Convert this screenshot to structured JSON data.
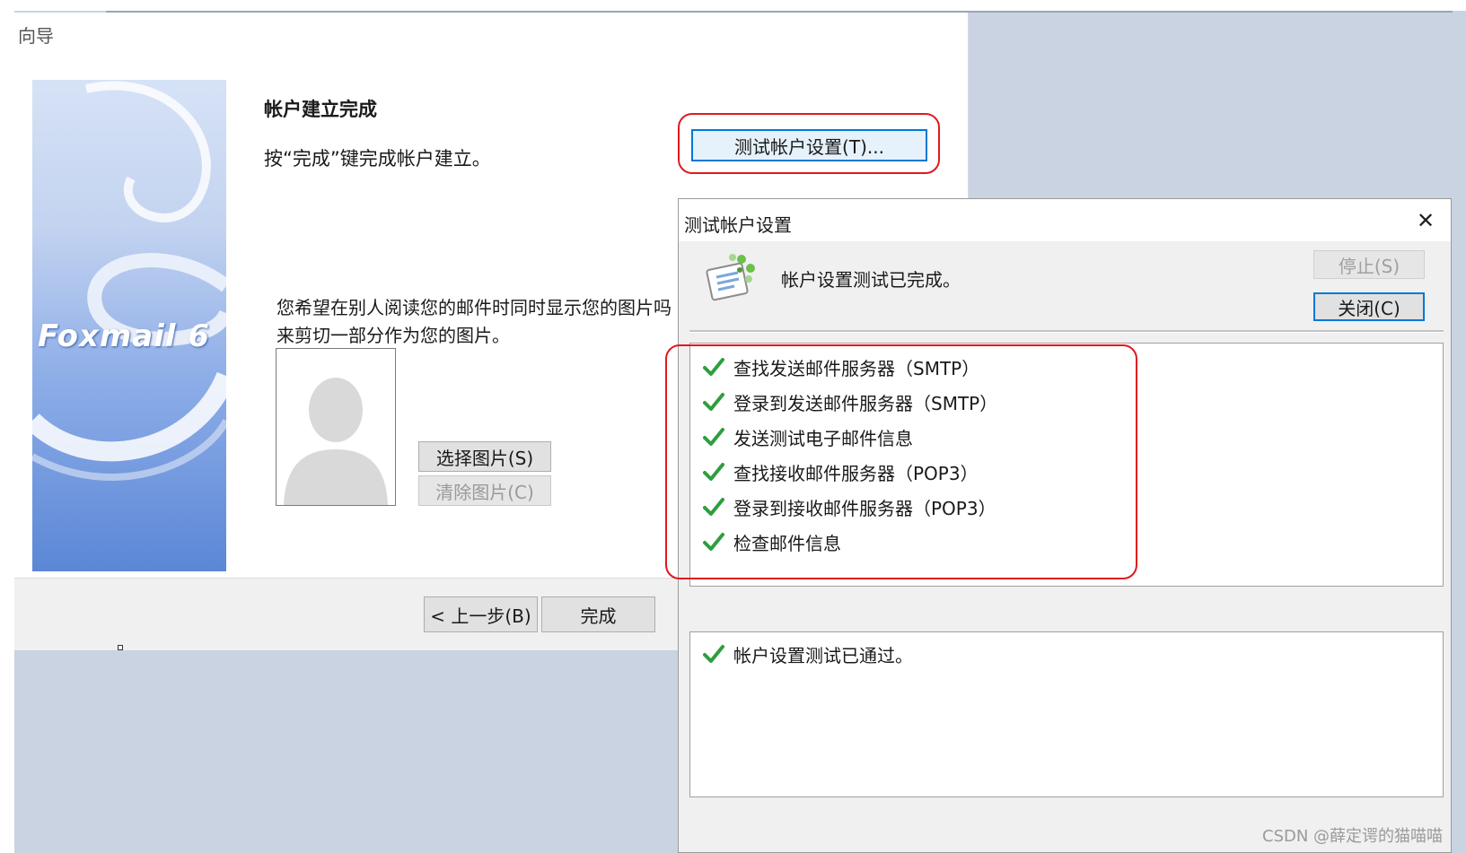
{
  "wizard": {
    "title": "向导",
    "banner_logo": "Foxmail 6",
    "heading": "帐户建立完成",
    "instruction": "按“完成”键完成帐户建立。",
    "test_button": "测试帐户设置(T)...",
    "picture_prompt_line1": "您希望在别人阅读您的邮件时同时显示您的图片吗",
    "picture_prompt_line2": "来剪切一部分作为您的图片。",
    "choose_picture": "选择图片(S)",
    "clear_picture": "清除图片(C)",
    "back_button": "< 上一步(B)",
    "finish_button": "完成"
  },
  "dialog": {
    "title": "测试帐户设置",
    "status": "帐户设置测试已完成。",
    "stop_button": "停止(S)",
    "close_button": "关闭(C)",
    "tasks": [
      {
        "label": "查找发送邮件服务器（SMTP）",
        "status": "done"
      },
      {
        "label": "登录到发送邮件服务器（SMTP）",
        "status": "done"
      },
      {
        "label": "发送测试电子邮件信息",
        "status": "done"
      },
      {
        "label": "查找接收邮件服务器（POP3）",
        "status": "done"
      },
      {
        "label": "登录到接收邮件服务器（POP3）",
        "status": "done"
      },
      {
        "label": "检查邮件信息",
        "status": "done"
      }
    ],
    "result": "帐户设置测试已通过。"
  },
  "colors": {
    "accent_blue": "#0078d7",
    "highlight_red": "#e0191f",
    "check_green": "#2e9e3e"
  },
  "watermark": "CSDN @薛定谔的猫喵喵"
}
